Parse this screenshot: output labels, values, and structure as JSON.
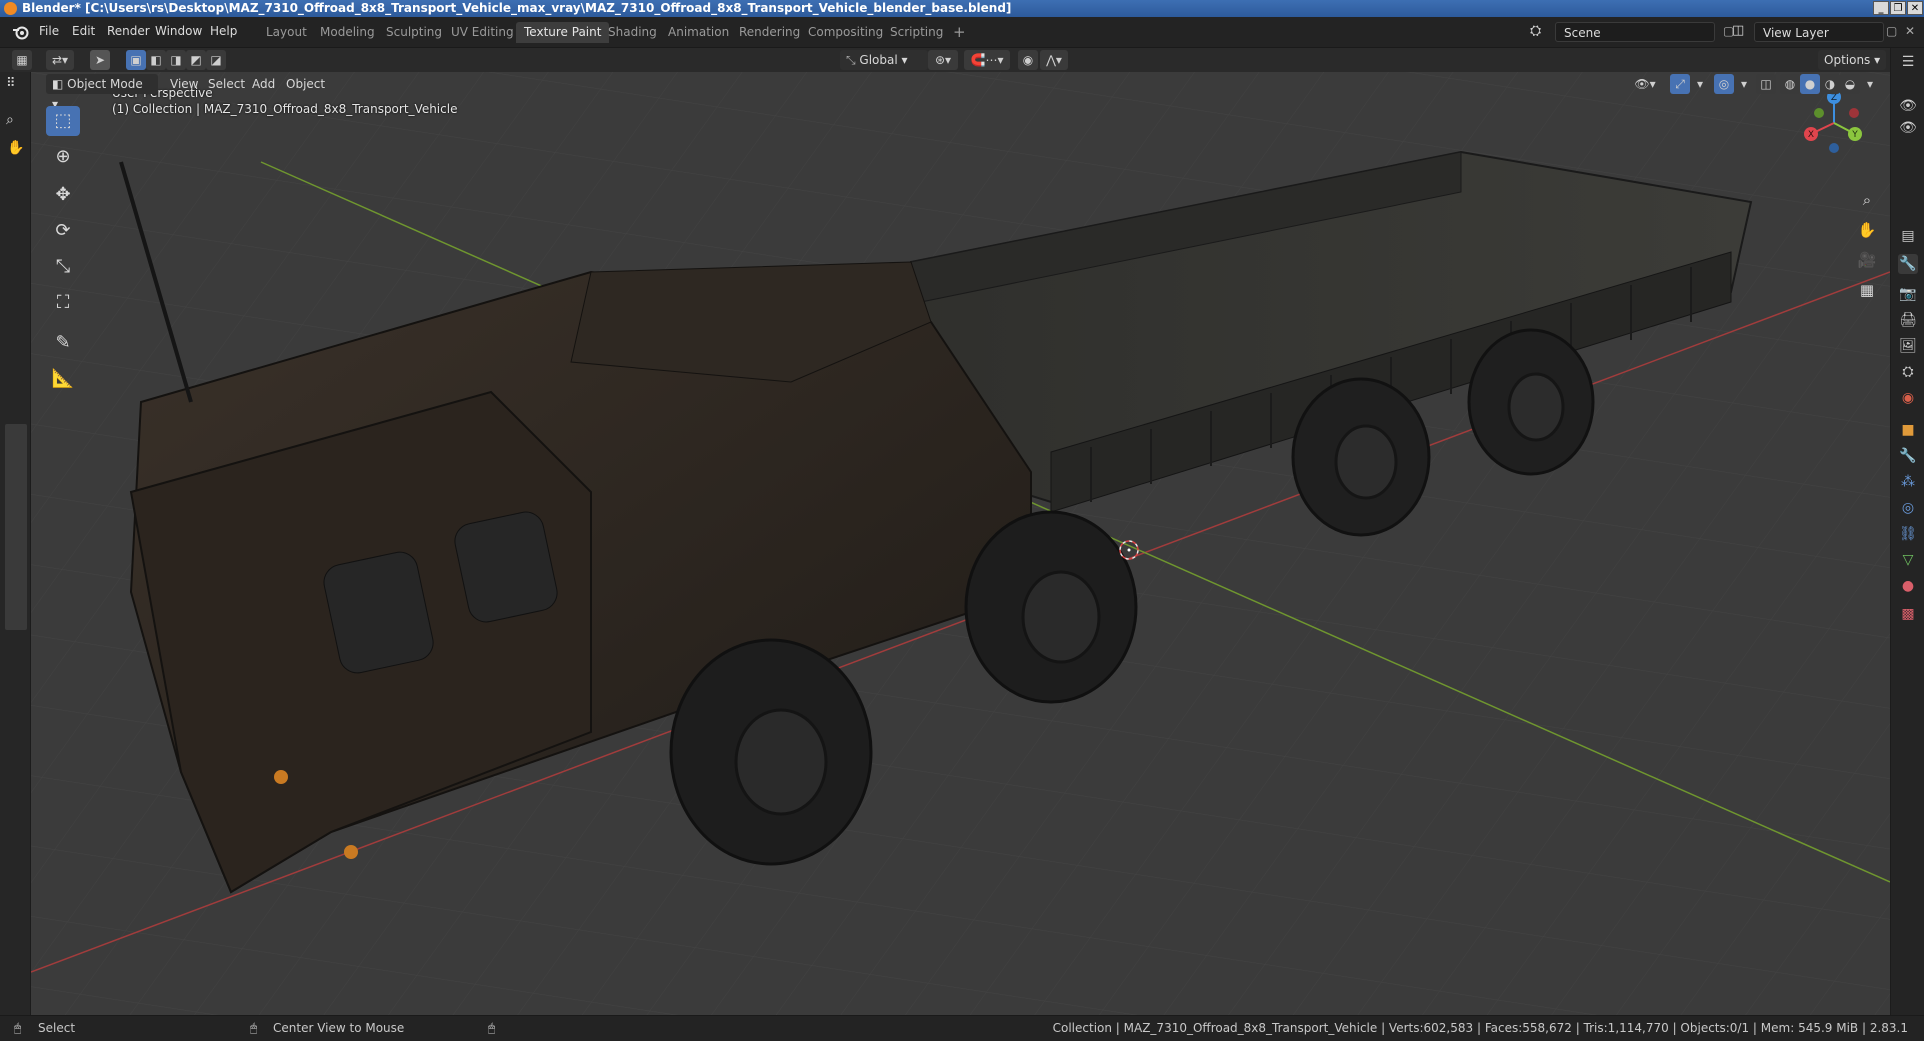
{
  "window": {
    "title": "Blender* [C:\\Users\\rs\\Desktop\\MAZ_7310_Offroad_8x8_Transport_Vehicle_max_vray\\MAZ_7310_Offroad_8x8_Transport_Vehicle_blender_base.blend]"
  },
  "menu": [
    "File",
    "Edit",
    "Render",
    "Window",
    "Help"
  ],
  "workspace_tabs": [
    {
      "label": "Layout",
      "active": false
    },
    {
      "label": "Modeling",
      "active": false
    },
    {
      "label": "Sculpting",
      "active": false
    },
    {
      "label": "UV Editing",
      "active": false
    },
    {
      "label": "Texture Paint",
      "active": true
    },
    {
      "label": "Shading",
      "active": false
    },
    {
      "label": "Animation",
      "active": false
    },
    {
      "label": "Rendering",
      "active": false
    },
    {
      "label": "Compositing",
      "active": false
    },
    {
      "label": "Scripting",
      "active": false
    }
  ],
  "add_workspace_label": "+",
  "scene": {
    "name": "Scene"
  },
  "view_layer": {
    "name": "View Layer"
  },
  "tool_header": {
    "transform_orientation": "Global",
    "options_label": "Options"
  },
  "view_header": {
    "mode": "Object Mode",
    "menus": [
      "View",
      "Select",
      "Add",
      "Object"
    ]
  },
  "viewport": {
    "perspective_label": "User Perspective",
    "collection_label": "(1) Collection | MAZ_7310_Offroad_8x8_Transport_Vehicle",
    "gizmo_axes": {
      "x": "X",
      "y": "Y",
      "z": "Z"
    }
  },
  "status_bar": {
    "left_action": "Select",
    "middle_action": "Center View to Mouse",
    "stats": "Collection | MAZ_7310_Offroad_8x8_Transport_Vehicle | Verts:602,583 | Faces:558,672 | Tris:1,114,770 | Objects:0/1 | Mem: 545.9 MiB | 2.83.1"
  },
  "colors": {
    "accent": "#4772b3",
    "grid_x_axis": "#b0413e",
    "grid_y_axis": "#7aa33a",
    "title_bar": "#2d5a9b",
    "axis_x": "#e0454d",
    "axis_y": "#8bc63e",
    "axis_z": "#3d8fe0"
  },
  "tools": [
    "select-box-tool",
    "cursor-tool",
    "move-tool",
    "rotate-tool",
    "scale-tool",
    "transform-tool",
    "annotate-tool",
    "measure-tool"
  ]
}
